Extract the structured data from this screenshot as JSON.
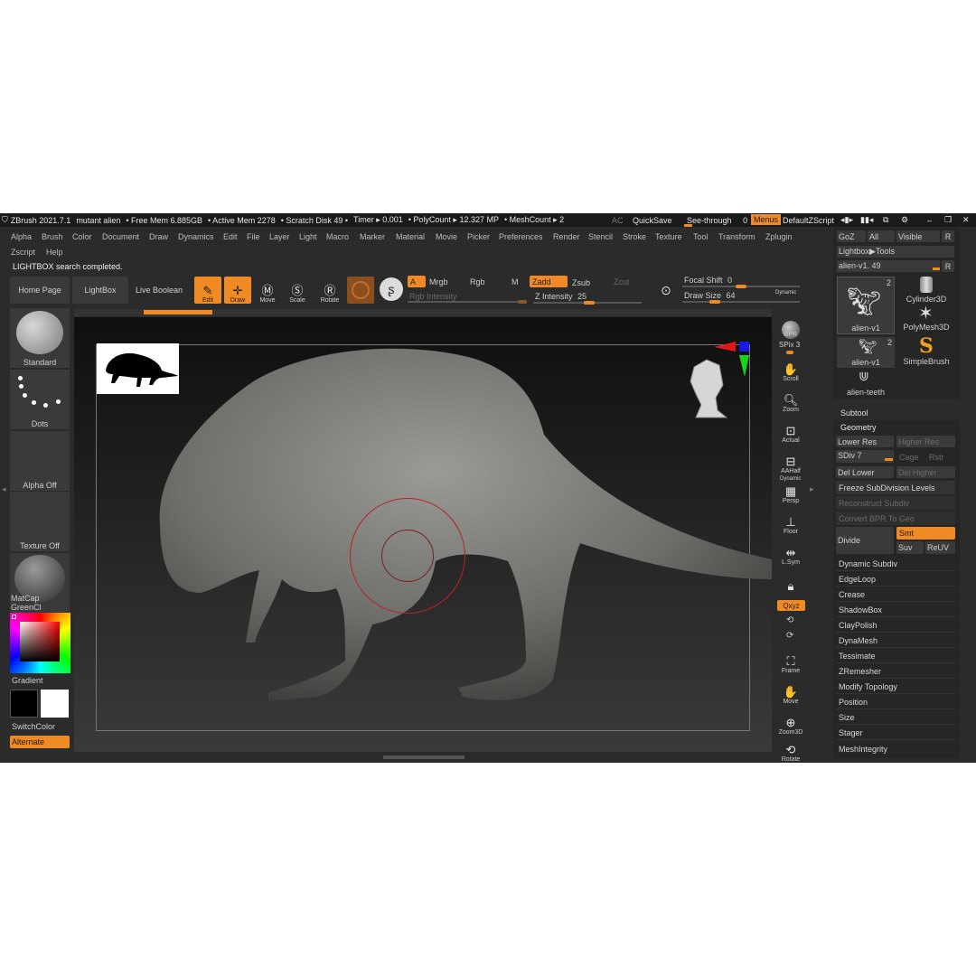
{
  "titlebar": {
    "app": "ZBrush 2021.7.1",
    "doc": "mutant alien",
    "free_mem": "• Free Mem 6.885GB",
    "active_mem": "• Active Mem 2278",
    "scratch": "• Scratch Disk 49 •",
    "timer": "Timer ▸ 0.001",
    "polycount": "• PolyCount ▸ 12.327 MP",
    "meshcount": "• MeshCount ▸ 2",
    "ac": "AC",
    "quicksave": "QuickSave",
    "see_through": "See-through",
    "see_through_val": "0",
    "menus": "Menus",
    "default_zscript": "DefaultZScript"
  },
  "menus": [
    "Alpha",
    "Brush",
    "Color",
    "Document",
    "Draw",
    "Dynamics",
    "Edit",
    "File",
    "Layer",
    "Light",
    "Macro",
    "Marker",
    "Material",
    "Movie",
    "Picker",
    "Preferences",
    "Render",
    "Stencil",
    "Stroke",
    "Texture",
    "Tool",
    "Transform",
    "Zplugin"
  ],
  "menus_row2": [
    "Zscript",
    "Help"
  ],
  "status": "LIGHTBOX search completed.",
  "shelf": {
    "home_page": "Home Page",
    "lightbox": "LightBox",
    "live_boolean": "Live Boolean",
    "edit": "Edit",
    "draw": "Draw",
    "move": "Move",
    "scale": "Scale",
    "rotate": "Rotate",
    "a": "A",
    "mrgb": "Mrgb",
    "rgb": "Rgb",
    "m": "M",
    "rgb_intensity": "Rgb Intensity",
    "zadd": "Zadd",
    "zsub": "Zsub",
    "zcut": "Zcut",
    "z_intensity": "Z Intensity",
    "z_intensity_val": "25",
    "focal_shift": "Focal Shift",
    "focal_shift_val": "0",
    "draw_size": "Draw Size",
    "draw_size_val": "64",
    "dynamic": "Dynamic"
  },
  "left": {
    "standard": "Standard",
    "dots": "Dots",
    "alpha_off": "Alpha Off",
    "texture_off": "Texture Off",
    "matcap": "MatCap GreenCl",
    "gradient": "Gradient",
    "switchcolor": "SwitchColor",
    "alternate": "Alternate"
  },
  "right_nav": {
    "bpr": "BPR",
    "spix": "SPix",
    "spix_val": "3",
    "scroll": "Scroll",
    "zoom": "Zoom",
    "actual": "Actual",
    "aahalf": "AAHalf",
    "dynamic": "Dynamic",
    "persp": "Persp",
    "floor": "Floor",
    "lsym": "L.Sym",
    "xyz": "Qxyz",
    "frame": "Frame",
    "move": "Move",
    "zoom3d": "Zoom3D",
    "rotate": "Rotate"
  },
  "tool": {
    "goz": "GoZ",
    "all": "All",
    "visible": "Visible",
    "r": "R",
    "lightbox_tools": "Lightbox▶Tools",
    "current": "alien-v1. 49",
    "thumbs": [
      {
        "name": "alien-v1",
        "count": "2"
      },
      {
        "name": "Cylinder3D"
      },
      {
        "name": "PolyMesh3D"
      },
      {
        "name": "alien-v1",
        "count": "2"
      },
      {
        "name": "SimpleBrush"
      },
      {
        "name": "alien-teeth"
      }
    ],
    "subtool": "Subtool",
    "geometry": "Geometry",
    "lower_res": "Lower Res",
    "higher_res": "Higher Res",
    "sdiv": "SDiv 7",
    "cage": "Cage",
    "rstr": "Rstr",
    "del_lower": "Del Lower",
    "del_higher": "Del Higher",
    "freeze": "Freeze SubDivision Levels",
    "reconstruct": "Reconstruct Subdiv",
    "convert_bpr": "Convert BPR To Geo",
    "divide": "Divide",
    "smt": "Smt",
    "suv": "Suv",
    "reuv": "ReUV",
    "items": [
      "Dynamic Subdiv",
      "EdgeLoop",
      "Crease",
      "ShadowBox",
      "ClayPolish",
      "DynaMesh",
      "Tessimate",
      "ZRemesher",
      "Modify Topology",
      "Position",
      "Size",
      "Stager",
      "MeshIntegrity"
    ]
  }
}
